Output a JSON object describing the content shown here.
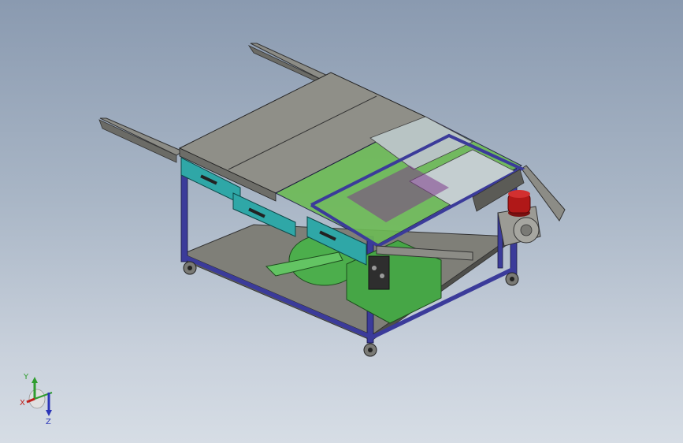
{
  "view": {
    "background_top": "#8a9ab0",
    "background_bottom": "#d6dde5"
  },
  "model": {
    "frame_color": "#3b3b9a",
    "panel_color": "#8f8f88",
    "drawer_color": "#2fa7a7",
    "mesh_color": "#6dbb55",
    "motor_color": "#4cae4c",
    "beacon_color": "#b01818"
  },
  "triad": {
    "x_label": "X",
    "y_label": "Y",
    "z_label": "Z",
    "x_color": "#c0201b",
    "y_color": "#2f9d2f",
    "z_color": "#2b35b8"
  }
}
